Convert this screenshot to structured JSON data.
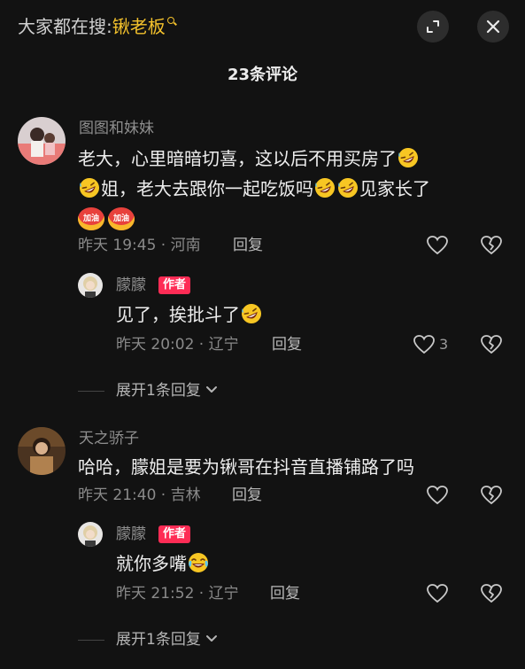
{
  "header": {
    "search_hint_prefix": "大家都在搜:",
    "search_keyword": "锹老板",
    "comment_count": "23条评论"
  },
  "comments": [
    {
      "user": "图图和妹妹",
      "line1": "老大，心里暗暗切喜，这以后不用买房了",
      "line2_a": "姐，老大去跟你一起吃饭吗",
      "line2_b": "见家长了",
      "sticker_text": "加油",
      "time": "昨天 19:45 · 河南",
      "reply_label": "回复",
      "replies": [
        {
          "user": "朦朦",
          "badge": "作者",
          "text": "见了，挨批斗了",
          "time": "昨天 20:02 · 辽宁",
          "reply_label": "回复",
          "likes": "3"
        }
      ],
      "expand_label": "展开1条回复"
    },
    {
      "user": "天之骄子",
      "line1": "哈哈，朦姐是要为锹哥在抖音直播铺路了吗",
      "time": "昨天 21:40 · 吉林",
      "reply_label": "回复",
      "replies": [
        {
          "user": "朦朦",
          "badge": "作者",
          "text": "就你多嘴",
          "time": "昨天 21:52 · 辽宁",
          "reply_label": "回复"
        }
      ],
      "expand_label": "展开1条回复"
    }
  ],
  "icons": {
    "expand": "expand-icon",
    "close": "close-icon",
    "like": "heart-icon",
    "dislike": "broken-heart-icon",
    "laugh": "rofl-emoji",
    "cry_laugh": "tears-of-joy-emoji"
  },
  "colors": {
    "background": "#121212",
    "keyword": "#f3c12c",
    "author_badge": "#fe2c55"
  }
}
